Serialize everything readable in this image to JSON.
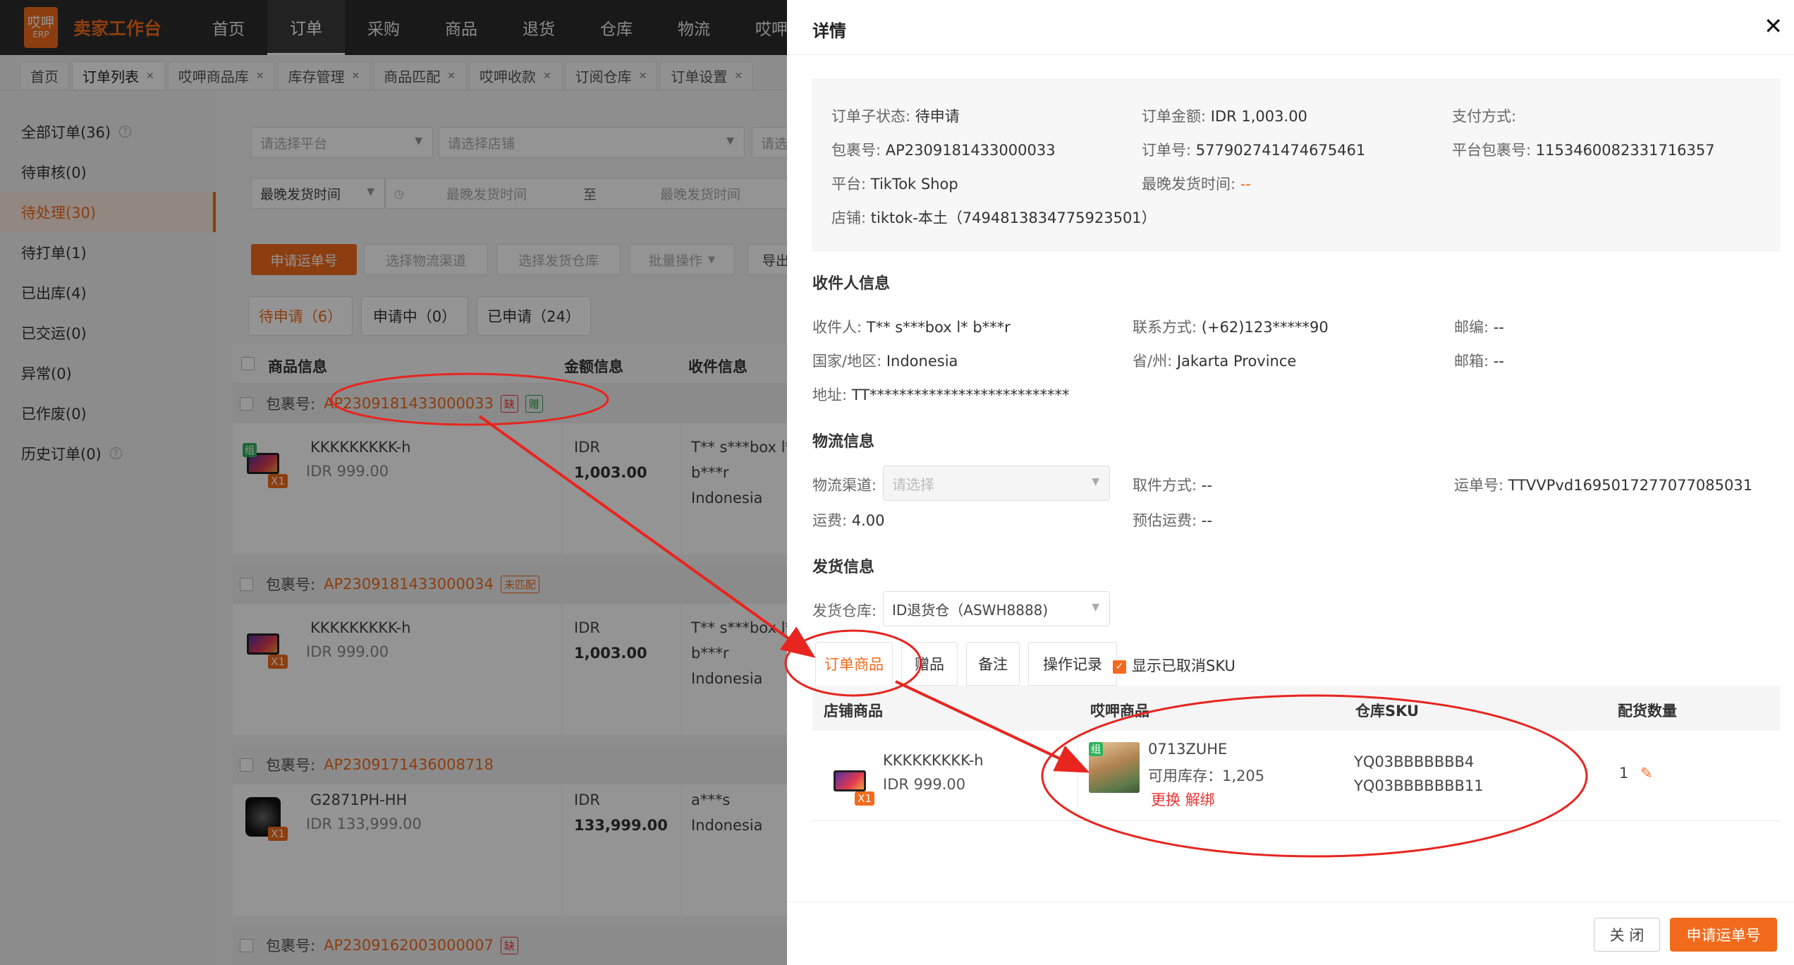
{
  "topbar": {
    "logo_text": "哎呷",
    "logo_sub": "ERP",
    "app_name": "卖家工作台",
    "nav": [
      "首页",
      "订单",
      "采购",
      "商品",
      "退货",
      "仓库",
      "物流",
      "哎呷收款"
    ],
    "active_nav": "订单"
  },
  "tabs": [
    {
      "label": "首页",
      "closable": false
    },
    {
      "label": "订单列表",
      "closable": true
    },
    {
      "label": "哎呷商品库",
      "closable": true
    },
    {
      "label": "库存管理",
      "closable": true
    },
    {
      "label": "商品匹配",
      "closable": true
    },
    {
      "label": "哎呷收款",
      "closable": true
    },
    {
      "label": "订阅仓库",
      "closable": true
    },
    {
      "label": "订单设置",
      "closable": true
    }
  ],
  "sidebar": {
    "items": [
      {
        "label": "全部订单(36)",
        "help": true
      },
      {
        "label": "待审核(0)"
      },
      {
        "label": "待处理(30)",
        "active": true
      },
      {
        "label": "待打单(1)"
      },
      {
        "label": "已出库(4)"
      },
      {
        "label": "已交运(0)"
      },
      {
        "label": "异常(0)"
      },
      {
        "label": "已作废(0)"
      },
      {
        "label": "历史订单(0)",
        "help": true
      }
    ]
  },
  "filters": {
    "platform_placeholder": "请选择平台",
    "store_placeholder": "请选择店铺",
    "more_placeholder": "请选",
    "time_select": "最晚发货时间",
    "date_start": "最晚发货时间",
    "date_to": "至",
    "date_end": "最晚发货时间"
  },
  "actions": {
    "apply_tracking": "申请运单号",
    "select_channel": "选择物流渠道",
    "select_warehouse": "选择发货仓库",
    "batch_ops": "批量操作",
    "export": "导出"
  },
  "status_tabs": [
    "待申请（6）",
    "申请中（0）",
    "已申请（24）"
  ],
  "table": {
    "headers": [
      "商品信息",
      "金额信息",
      "收件信息"
    ],
    "orders": [
      {
        "pkg_label": "包裹号:",
        "pkg_no": "AP2309181433000033",
        "tags": [
          "缺",
          "赠"
        ],
        "product": "KKKKKKKKK-h",
        "price": "IDR 999.00",
        "amount_currency": "IDR",
        "amount": "1,003.00",
        "recipient": "T** s***box l*",
        "recipient2": "b***r",
        "country": "Indonesia",
        "combo": true,
        "qty": "X1"
      },
      {
        "pkg_label": "包裹号:",
        "pkg_no": "AP2309181433000034",
        "tags": [
          "未匹配"
        ],
        "product": "KKKKKKKKK-h",
        "price": "IDR 999.00",
        "amount_currency": "IDR",
        "amount": "1,003.00",
        "recipient": "T** s***box l*",
        "recipient2": "b***r",
        "country": "Indonesia",
        "qty": "X1"
      },
      {
        "pkg_label": "包裹号:",
        "pkg_no": "AP2309171436008718",
        "tags": [],
        "product": "G2871PH-HH",
        "price": "IDR 133,999.00",
        "amount_currency": "IDR",
        "amount": "133,999.00",
        "recipient": "a***s",
        "country": "Indonesia",
        "qty": "X1"
      },
      {
        "pkg_label": "包裹号:",
        "pkg_no": "AP2309162003000007",
        "tags": [
          "缺"
        ]
      }
    ]
  },
  "drawer": {
    "title": "详情",
    "summary": {
      "sub_status_label": "订单子状态:",
      "sub_status": "待申请",
      "amount_label": "订单金额:",
      "amount": "IDR 1,003.00",
      "payment_label": "支付方式:",
      "payment": "",
      "pkg_label": "包裹号:",
      "pkg": "AP2309181433000033",
      "order_no_label": "订单号:",
      "order_no": "577902741474675461",
      "platform_pkg_label": "平台包裹号:",
      "platform_pkg": "1153460082331716357",
      "platform_label": "平台:",
      "platform": "TikTok Shop",
      "ship_by_label": "最晚发货时间:",
      "ship_by": "--",
      "store_label": "店铺:",
      "store": "tiktok-本土（7494813834775923501）"
    },
    "recipient": {
      "title": "收件人信息",
      "name_label": "收件人:",
      "name": "T** s***box l* b***r",
      "phone_label": "联系方式:",
      "phone": "(+62)123*****90",
      "zip_label": "邮编:",
      "zip": "--",
      "country_label": "国家/地区:",
      "country": "Indonesia",
      "province_label": "省/州:",
      "province": "Jakarta Province",
      "email_label": "邮箱:",
      "email": "--",
      "address_label": "地址:",
      "address": "TT***************************"
    },
    "logistics": {
      "title": "物流信息",
      "channel_label": "物流渠道:",
      "channel_placeholder": "请选择",
      "pickup_label": "取件方式:",
      "pickup": "--",
      "tracking_label": "运单号:",
      "tracking": "TTVVPvd1695017277077085031",
      "fee_label": "运费:",
      "fee": "4.00",
      "est_fee_label": "预估运费:",
      "est_fee": "--"
    },
    "shipping": {
      "title": "发货信息",
      "warehouse_label": "发货仓库:",
      "warehouse": "ID退货仓（ASWH8888)"
    },
    "tabs": [
      "订单商品",
      "赠品",
      "备注",
      "操作记录"
    ],
    "show_cancelled_sku": "显示已取消SKU",
    "items_table": {
      "headers": [
        "店铺商品",
        "哎呷商品",
        "仓库SKU",
        "配货数量"
      ],
      "rows": [
        {
          "store_product": "KKKKKKKKK-h",
          "store_price": "IDR 999.00",
          "qty_badge": "X1",
          "aiya_badge": "组",
          "aiya_product": "0713ZUHE",
          "stock_label": "可用库存：",
          "stock": "1,205",
          "replace": "更换",
          "unbind": "解绑",
          "skus": [
            "YQ03BBBBBBB4",
            "YQ03BBBBBBB11"
          ],
          "alloc_qty": "1"
        }
      ]
    },
    "footer": {
      "close": "关 闭",
      "apply": "申请运单号"
    }
  },
  "colors": {
    "accent": "#f26b1d",
    "annotation": "#e8251f"
  }
}
